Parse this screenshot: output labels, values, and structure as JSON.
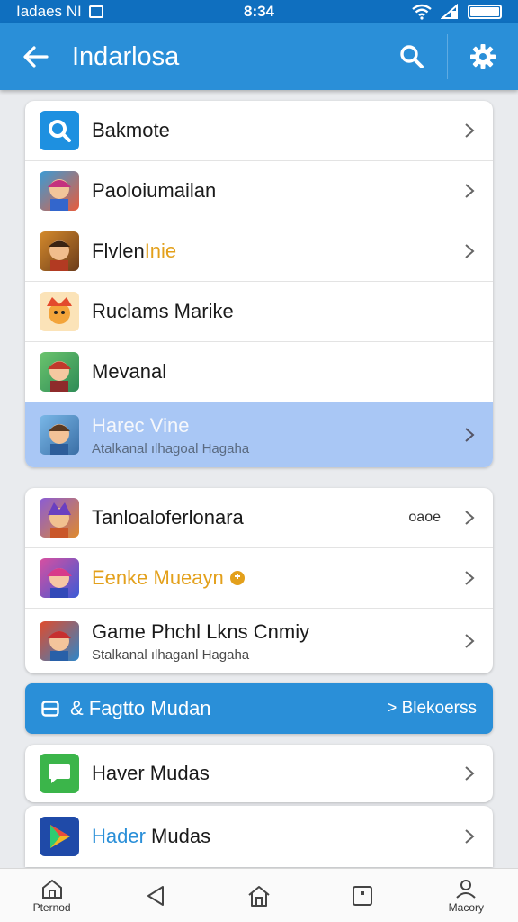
{
  "status_bar": {
    "left_text": "Iadaes NI",
    "time": "8:34"
  },
  "app_bar": {
    "title": "Indarlosa",
    "back_icon": "arrow-left-icon",
    "search_icon": "search-icon",
    "settings_icon": "gear-icon"
  },
  "group1": {
    "items": [
      {
        "label": "Bakmote",
        "icon": "search-app-icon"
      },
      {
        "label": "Paoloiumailan",
        "icon": "game-character-icon"
      },
      {
        "label_part1": "Flvlen",
        "label_part2": "Inie",
        "icon": "game-character-icon"
      },
      {
        "label": "Ruclams Marike",
        "icon": "game-character-icon"
      },
      {
        "label": "Mevanal",
        "icon": "game-character-icon"
      },
      {
        "label": "Harec Vine",
        "sub": "Atalkanal ılhagoal Hagaha",
        "icon": "game-character-icon"
      }
    ]
  },
  "group2": {
    "items": [
      {
        "label": "Tanloaloferlonara",
        "meta": "oaoe",
        "icon": "game-character-icon"
      },
      {
        "label": "Eenke Mueayn",
        "icon": "game-character-icon"
      },
      {
        "label": "Game Phchl Lkns Cnmiy",
        "sub": "Stalkanal ılhaganl Hagaha",
        "icon": "game-character-icon"
      }
    ]
  },
  "banner": {
    "label": "& Fagtto Mudan",
    "action": "> Blekoerss",
    "icon": "storage-icon"
  },
  "group3": {
    "item": {
      "label": "Haver Mudas",
      "icon": "chat-app-icon"
    }
  },
  "group4": {
    "item": {
      "label_part1": "Hader",
      "label_part2": "Mudas",
      "icon": "play-store-icon"
    }
  },
  "bottom_nav": {
    "items": [
      {
        "label": "Pternod",
        "icon": "home-outline-icon"
      },
      {
        "label": "",
        "icon": "back-triangle-icon"
      },
      {
        "label": "",
        "icon": "home-icon"
      },
      {
        "label": "",
        "icon": "recents-square-icon"
      },
      {
        "label": "Macory",
        "icon": "person-icon"
      }
    ]
  },
  "colors": {
    "status_bar": "#0f6fbf",
    "app_bar": "#2a8fd8",
    "highlight_row": "#a9c7f5",
    "accent_orange": "#e3a01b",
    "accent_blue": "#2a8fd8"
  }
}
